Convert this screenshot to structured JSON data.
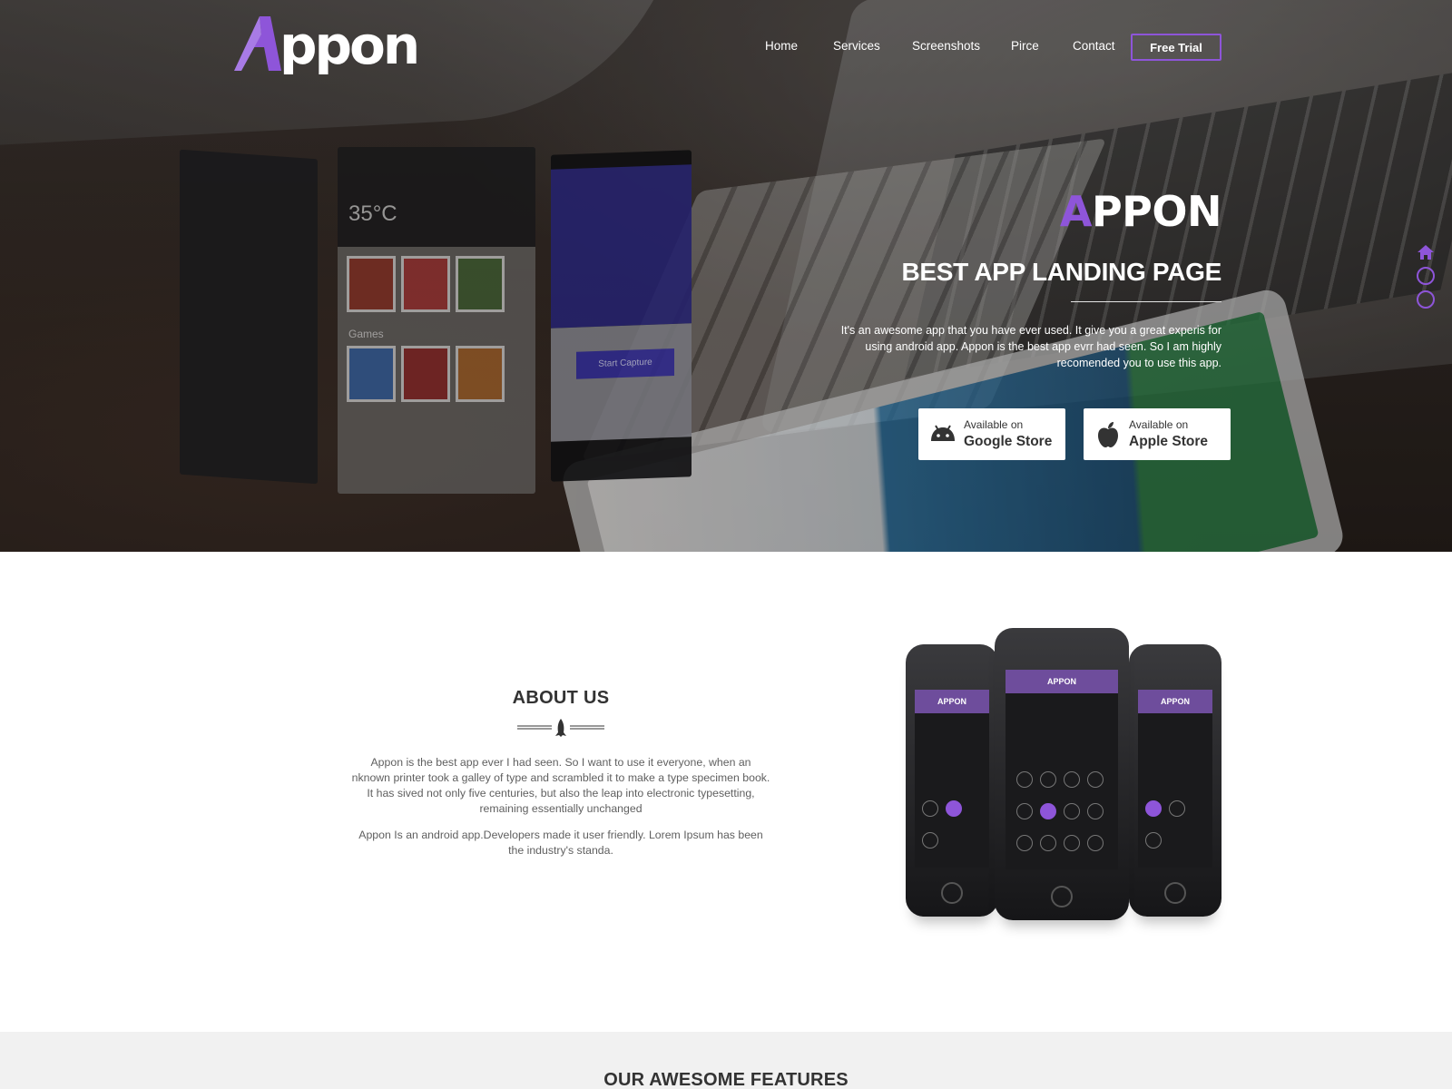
{
  "brand": {
    "logo_text": "ppon",
    "logo_letter": "A",
    "accent": "#8e55d9"
  },
  "nav": {
    "items": [
      "Home",
      "Services",
      "Screenshots",
      "Pirce",
      "Contact"
    ],
    "cta": "Free Trial"
  },
  "hero": {
    "title_accent": "A",
    "title_rest": "PPON",
    "subtitle": "BEST APP LANDING PAGE",
    "description": "It's an awesome app that you have ever used. It give you a great experis for using android app. Appon is the best app evrr had seen. So I am highly recomended you to use this app.",
    "stores": [
      {
        "available": "Available on",
        "name": "Google Store",
        "icon": "android-icon"
      },
      {
        "available": "Available on",
        "name": "Apple Store",
        "icon": "apple-icon"
      }
    ],
    "mock_screen": {
      "temperature": "35°C",
      "capture": "Start Capture",
      "games": "Games"
    }
  },
  "about": {
    "title": "ABOUT US",
    "paragraph1": "Appon is the best app ever I had seen. So I want to use it everyone, when an nknown printer took a galley of type and scrambled it to make a type specimen book. It has sived not only five centuries, but also the leap into electronic typesetting, remaining essentially unchanged",
    "paragraph2": "Appon Is an android app.Developers made it user friendly. Lorem Ipsum has been the industry's standa.",
    "phone_header": "APPON"
  },
  "features": {
    "title": "OUR AWESOME FEATURES"
  },
  "colors": {
    "accent": "#8e55d9",
    "section_gray": "#f1f1f1"
  }
}
